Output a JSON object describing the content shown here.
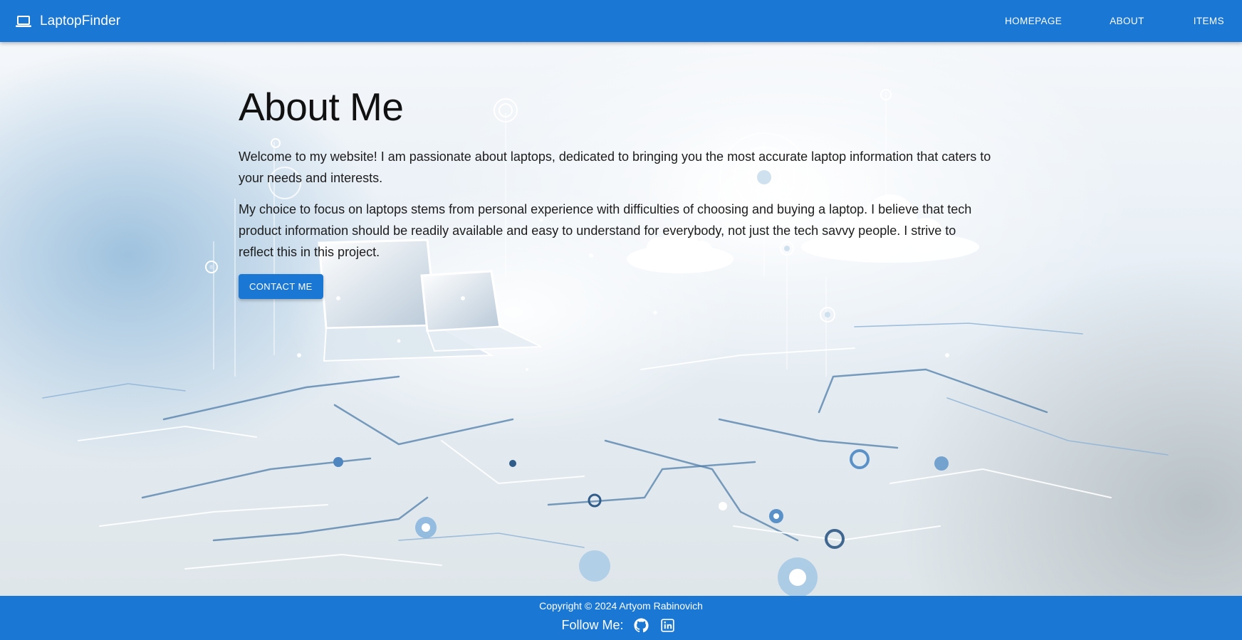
{
  "app": {
    "brand": "LaptopFinder",
    "brand_icon": "laptop-icon"
  },
  "nav": {
    "items": [
      {
        "label": "HOMEPAGE"
      },
      {
        "label": "ABOUT"
      },
      {
        "label": "ITEMS"
      }
    ]
  },
  "main": {
    "title": "About Me",
    "paragraphs": [
      "Welcome to my website! I am passionate about laptops, dedicated to bringing you the most accurate laptop information that caters to your needs and interests.",
      "My choice to focus on laptops stems from personal experience with difficulties of choosing and buying a laptop. I believe that tech product information should be readily available and easy to understand for everybody, not just the tech savvy people. I strive to reflect this in this project."
    ],
    "contact_button": "CONTACT ME"
  },
  "footer": {
    "copyright": "Copyright © 2024 Artyom Rabinovich",
    "follow_label": "Follow Me:",
    "social": [
      {
        "icon": "github-icon"
      },
      {
        "icon": "linkedin-icon"
      }
    ]
  },
  "colors": {
    "primary": "#1a77d4",
    "text": "#1c1c1c",
    "on_primary": "#ffffff"
  }
}
